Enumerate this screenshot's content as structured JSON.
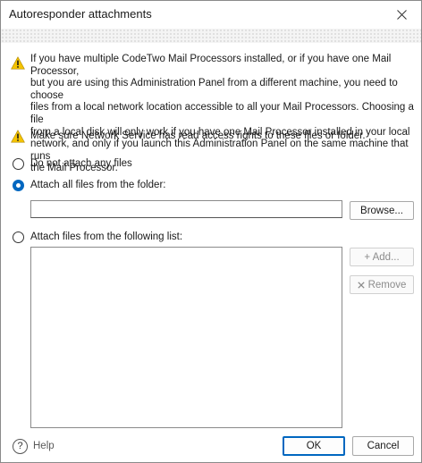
{
  "window": {
    "title": "Autoresponder attachments"
  },
  "warnings": [
    {
      "icon": "warning-icon",
      "lines": [
        "If you have multiple CodeTwo Mail Processors installed, or if you have one Mail Processor,",
        "but you are using this Administration Panel from a different machine, you need to choose",
        "files from a local network location accessible to all your Mail Processors. Choosing a file",
        "from a local disk will only work if you have one Mail Processor installed in your local",
        "network, and only if you launch this Administration Panel on the same machine that runs",
        "the Mail Processor."
      ]
    },
    {
      "icon": "warning-icon",
      "lines": [
        "Make sure Network Service has read access rights to these files or folder."
      ]
    }
  ],
  "options": [
    {
      "label": "Do not attach any files",
      "checked": false
    },
    {
      "label": "Attach all files from the folder:",
      "checked": true
    },
    {
      "label": "Attach files from the following list:",
      "checked": false
    }
  ],
  "folder": {
    "value": "",
    "browse_label": "Browse..."
  },
  "list": {
    "items": [],
    "add_label": "+ Add...",
    "remove_label": "Remove",
    "add_enabled": false,
    "remove_enabled": false
  },
  "footer": {
    "help_label": "Help",
    "ok_label": "OK",
    "cancel_label": "Cancel"
  },
  "colors": {
    "accent": "#0067c0",
    "warning": "#f5c400"
  }
}
